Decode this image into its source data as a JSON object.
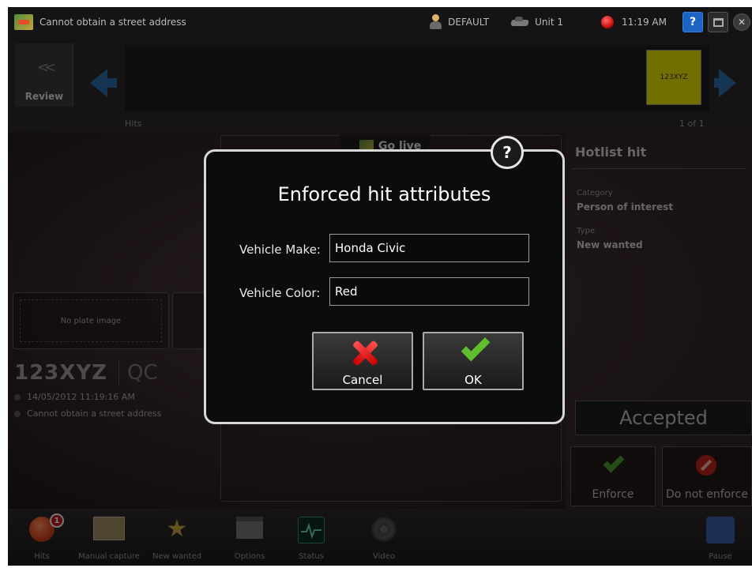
{
  "titlebar": {
    "status": "Cannot obtain a street address",
    "user": "DEFAULT",
    "unit": "Unit 1",
    "time": "11:19 AM",
    "help": "?"
  },
  "strip": {
    "review_label": "Review",
    "review_arrows": "<<",
    "hits_label": "Hits",
    "count": "1 of 1",
    "plate_thumb": "123XYZ"
  },
  "main": {
    "golive_label": "Go live",
    "no_plate_image": "No plate image",
    "plate": "123XYZ",
    "state": "QC",
    "timestamp": "14/05/2012 11:19:16 AM",
    "address": "Cannot obtain a street address"
  },
  "hotlist": {
    "title": "Hotlist hit",
    "category_label": "Category",
    "category_value": "Person of interest",
    "type_label": "Type",
    "type_value": "New wanted",
    "status": "Accepted",
    "enforce_label": "Enforce",
    "do_not_enforce_label": "Do not enforce"
  },
  "bottombar": {
    "items": [
      {
        "label": "Hits",
        "icon": "hits-icon"
      },
      {
        "label": "Manual capture",
        "icon": "manual-capture-icon"
      },
      {
        "label": "New wanted",
        "icon": "star-icon"
      },
      {
        "label": "Options",
        "icon": "options-icon"
      },
      {
        "label": "Status",
        "icon": "status-icon"
      },
      {
        "label": "Video",
        "icon": "video-icon"
      },
      {
        "label": "Pause",
        "icon": "pause-icon"
      }
    ],
    "hits_badge": "1"
  },
  "dialog": {
    "title": "Enforced hit attributes",
    "help": "?",
    "make_label": "Vehicle Make:",
    "make_value": "Honda Civic",
    "color_label": "Vehicle Color:",
    "color_value": "Red",
    "cancel_label": "Cancel",
    "ok_label": "OK"
  },
  "colors": {
    "accent_blue": "#1c64c4",
    "plate_yellow": "#e3df00",
    "ok_green": "#5fbd2e",
    "cancel_red": "#e02020"
  }
}
